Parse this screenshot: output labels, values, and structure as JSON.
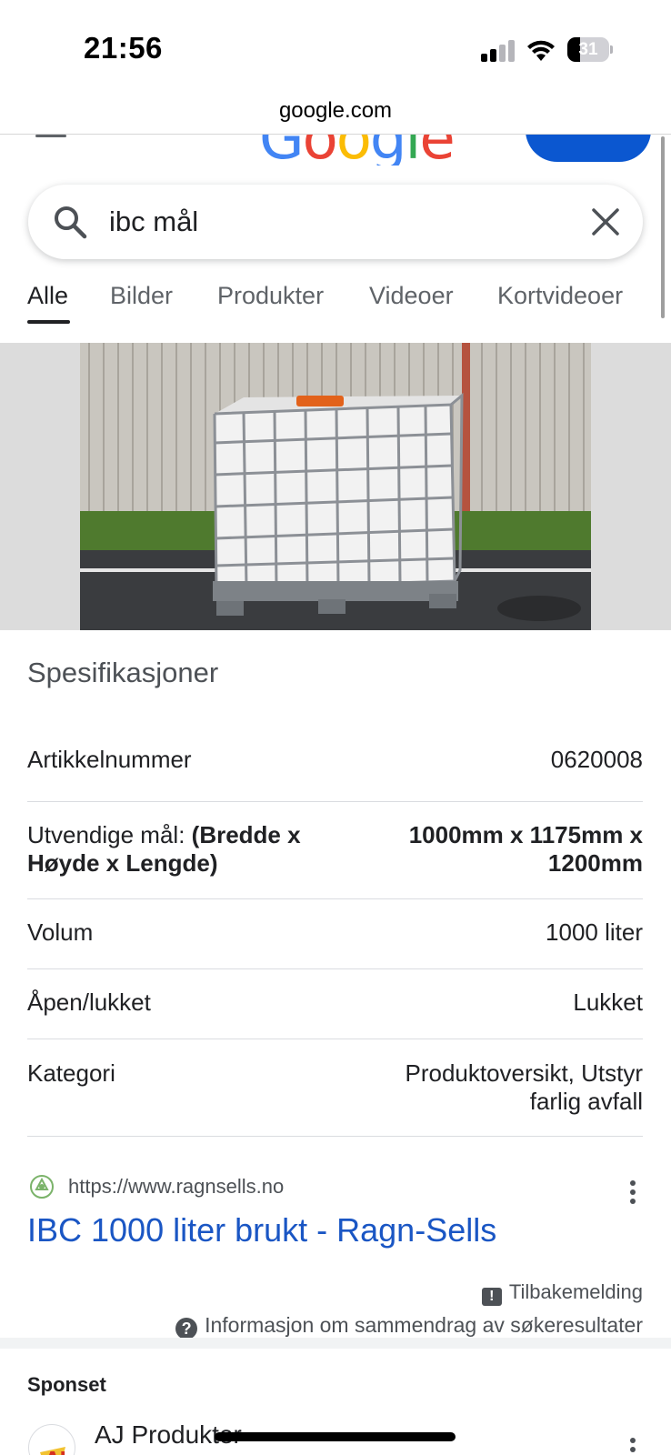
{
  "status_bar": {
    "time": "21:56",
    "battery": "31",
    "battery_level": 0.31
  },
  "browser": {
    "url": "google.com"
  },
  "header": {
    "logo_letters": [
      "G",
      "o",
      "o",
      "g",
      "l",
      "e"
    ],
    "logo_colors": [
      "#4285F4",
      "#EA4335",
      "#FBBC05",
      "#4285F4",
      "#34A853",
      "#EA4335"
    ]
  },
  "search": {
    "query": "ibc mål"
  },
  "tabs": [
    {
      "label": "Alle",
      "active": true
    },
    {
      "label": "Bilder"
    },
    {
      "label": "Produkter"
    },
    {
      "label": "Videoer"
    },
    {
      "label": "Kortvideoer"
    }
  ],
  "specs": {
    "title": "Spesifikasjoner",
    "rows": [
      {
        "key": "Artikkelnummer",
        "value": "0620008"
      },
      {
        "key_prefix": "Utvendige mål:",
        "key_bold": "(Bredde x Høyde x Lengde)",
        "value": "1000mm x 1175mm x 1200mm"
      },
      {
        "key": "Volum",
        "value": "1000 liter"
      },
      {
        "key": "Åpen/lukket",
        "value": "Lukket"
      },
      {
        "key": "Kategori",
        "value": "Produktoversikt, Utstyr farlig avfall"
      }
    ]
  },
  "result": {
    "url": "https://www.ragnsells.no",
    "title": "IBC 1000 liter brukt - Ragn-Sells",
    "feedback": "Tilbakemelding",
    "info": "Informasjon om sammendrag av søkeresultater"
  },
  "sponsored": {
    "label": "Sponset",
    "advertiser": "AJ Produkter"
  },
  "colors": {
    "link": "#1a56c4",
    "accent": "#0b57d0"
  }
}
